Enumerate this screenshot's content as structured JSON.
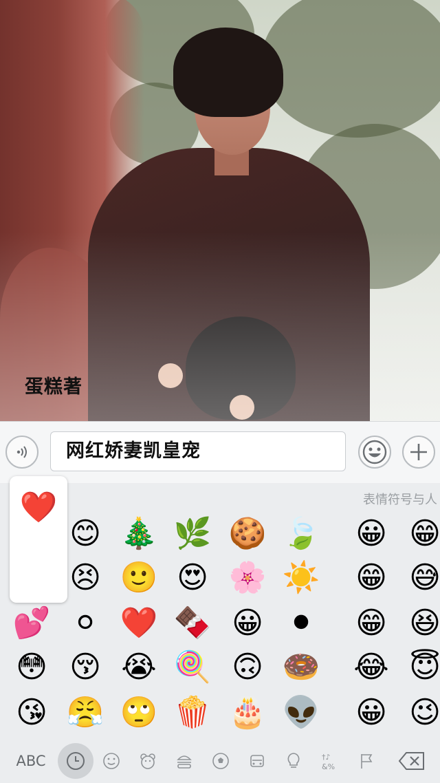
{
  "photo": {
    "caption": "蛋糕著"
  },
  "input_bar": {
    "voice_icon": "voice-icon",
    "text_value": "网红娇妻凯皇宠",
    "emoji_button_icon": "smiley-face-icon",
    "plus_button_icon": "plus-icon"
  },
  "emoji_panel": {
    "category_label": "表情符号与人",
    "preview_emoji": "❤️",
    "emojis": [
      [
        "😊",
        "🎄",
        "🌿",
        "🍪",
        "🍃",
        "😀",
        "😁"
      ],
      [
        "😣",
        "🙂",
        "😍",
        "🌸",
        "☀️",
        "😁",
        "😅"
      ],
      [
        "💕",
        "⚪",
        "❤️",
        "🍫",
        "😀",
        "⚫",
        "😁",
        "😆"
      ],
      [
        "😳",
        "😚",
        "😭",
        "🍭",
        "🙃",
        "🍩",
        "😂",
        "😇"
      ],
      [
        "😘",
        "😤",
        "🙄",
        "🍿",
        "🎂",
        "👽",
        "😀",
        "😉"
      ]
    ]
  },
  "toolbar": {
    "abc_label": "ABC",
    "icons": [
      "clock-icon",
      "smiley-icon",
      "bear-icon",
      "burger-icon",
      "soccer-ball-icon",
      "car-icon",
      "lightbulb-icon",
      "symbols-icon",
      "flag-icon",
      "backspace-icon"
    ]
  }
}
